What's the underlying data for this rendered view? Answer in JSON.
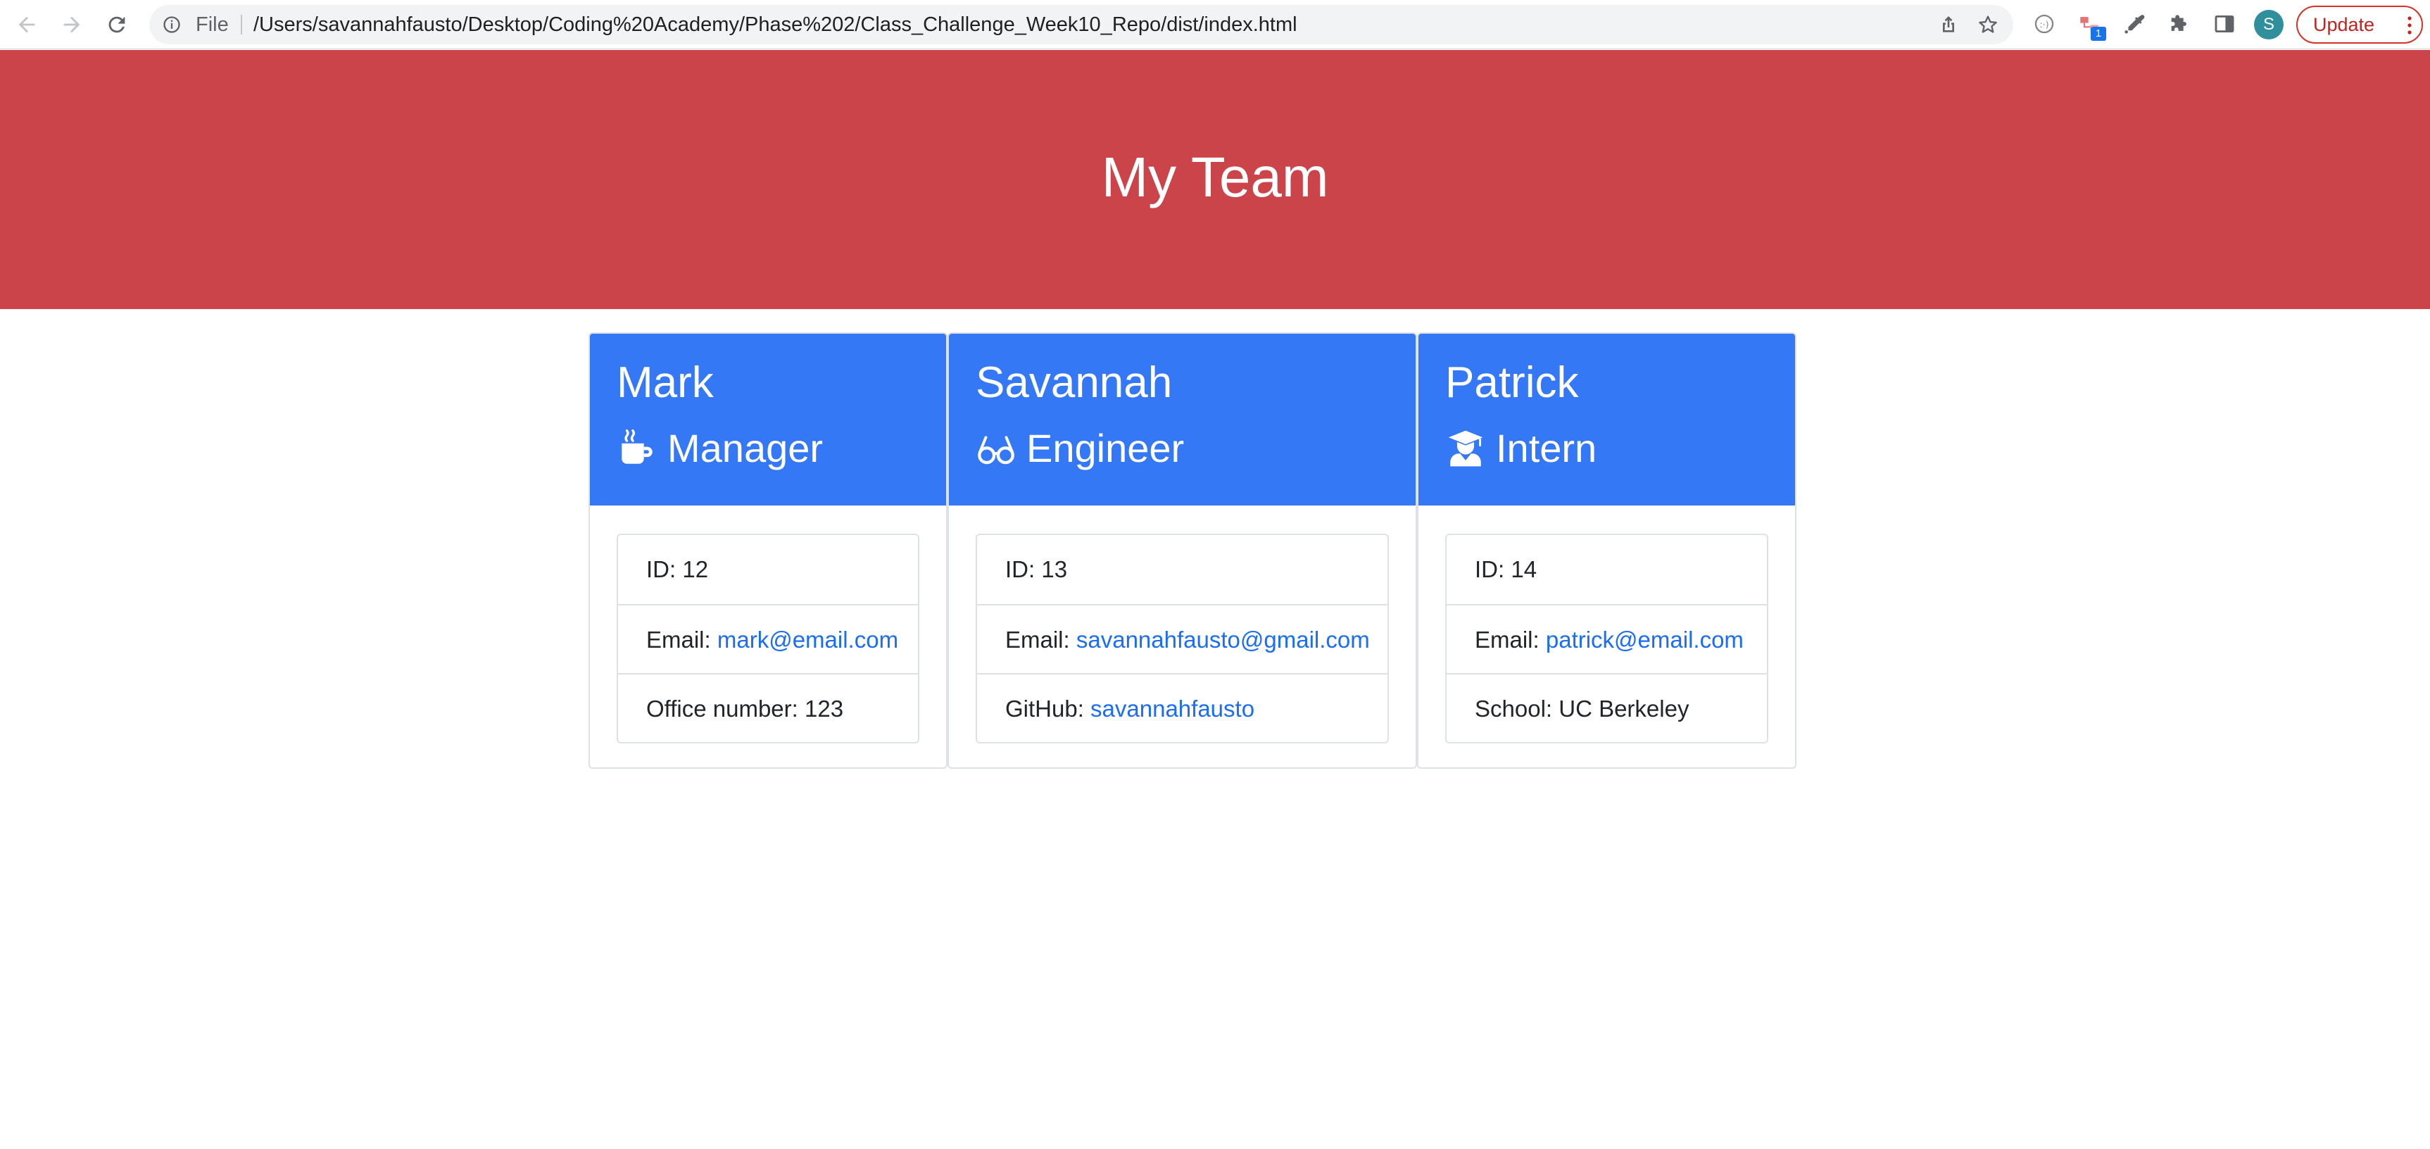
{
  "browser": {
    "file_label": "File",
    "url": "/Users/savannahfausto/Desktop/Coding%20Academy/Phase%202/Class_Challenge_Week10_Repo/dist/index.html",
    "extension_badge": "1",
    "avatar_letter": "S",
    "update_label": "Update"
  },
  "header": {
    "title": "My Team",
    "background_color": "#cb444a"
  },
  "cards": [
    {
      "name": "Mark",
      "role": "Manager",
      "role_icon": "coffee-mug-icon",
      "id": "ID: 12",
      "email_label": "Email: ",
      "email": "mark@email.com",
      "extra_label": "Office number: 123",
      "extra_link": ""
    },
    {
      "name": "Savannah",
      "role": "Engineer",
      "role_icon": "glasses-icon",
      "id": "ID: 13",
      "email_label": "Email: ",
      "email": "savannahfausto@gmail.com",
      "extra_label": "GitHub: ",
      "extra_link": "savannahfausto"
    },
    {
      "name": "Patrick",
      "role": "Intern",
      "role_icon": "graduate-icon",
      "id": "ID: 14",
      "email_label": "Email: ",
      "email": "patrick@email.com",
      "extra_label": "School: UC Berkeley",
      "extra_link": ""
    }
  ],
  "colors": {
    "card_header": "#3478f6",
    "link": "#1a6ef5"
  }
}
